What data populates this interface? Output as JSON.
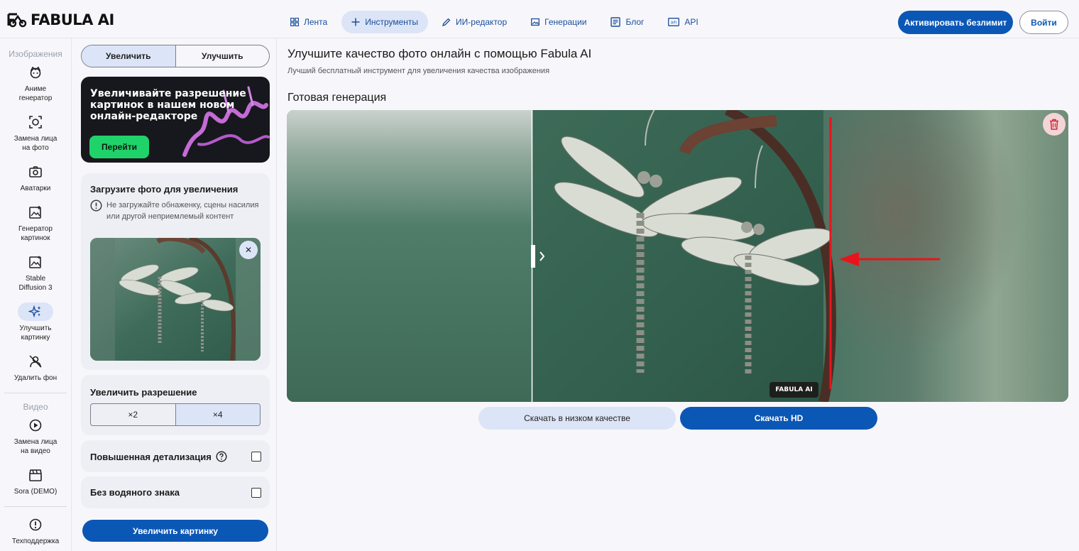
{
  "header": {
    "logo_text": "FABULA AI",
    "nav": [
      {
        "label": "Лента",
        "icon": "grid-icon"
      },
      {
        "label": "Инструменты",
        "icon": "plus-icon"
      },
      {
        "label": "ИИ-редактор",
        "icon": "pencil-icon"
      },
      {
        "label": "Генерации",
        "icon": "image-icon"
      },
      {
        "label": "Блог",
        "icon": "document-icon"
      },
      {
        "label": "API",
        "icon": "api-icon"
      }
    ],
    "activate_label": "Активировать безлимит",
    "login_label": "Войти"
  },
  "sidebar": {
    "images_section": "Изображения",
    "items": [
      {
        "line1": "Аниме",
        "line2": "генератор"
      },
      {
        "line1": "Замена лица",
        "line2": "на фото"
      },
      {
        "line1": "Аватарки",
        "line2": ""
      },
      {
        "line1": "Генератор",
        "line2": "картинок"
      },
      {
        "line1": "Stable",
        "line2": "Diffusion 3"
      },
      {
        "line1": "Улучшить",
        "line2": "картинку"
      },
      {
        "line1": "Удалить фон",
        "line2": ""
      }
    ],
    "video_section": "Видео",
    "video_items": [
      {
        "line1": "Замена лица",
        "line2": "на видео"
      },
      {
        "line1": "Sora (DEMO)",
        "line2": ""
      }
    ],
    "support_label": "Техподдержка"
  },
  "panel": {
    "mode_upscale": "Увеличить",
    "mode_enhance": "Улучшить",
    "banner_text": "Увеличивайте разрешение картинок в нашем новом онлайн-редакторе",
    "banner_button": "Перейти",
    "upload_title": "Загрузите фото для увеличения",
    "upload_warning": "Не загружайте обнаженку, сцены насилия или другой неприемлемый контент",
    "resolution_title": "Увеличить разрешение",
    "scale_options": [
      "×2",
      "×4"
    ],
    "detail_label": "Повышенная детализация",
    "no_watermark_label": "Без водяного знака",
    "submit_label": "Увеличить картинку"
  },
  "main": {
    "title": "Улучшите качество фото онлайн с помощью Fabula AI",
    "subtitle": "Лучший бесплатный инструмент для увеличения качества изображения",
    "result_title": "Готовая генерация",
    "watermark": "FABULA AI",
    "download_low": "Скачать в низком качестве",
    "download_hd": "Скачать HD"
  },
  "colors": {
    "accent": "#0b57b5",
    "accent_light": "#dce4f7",
    "banner_green": "#1fd36a",
    "annotation_red": "#e8141c"
  }
}
